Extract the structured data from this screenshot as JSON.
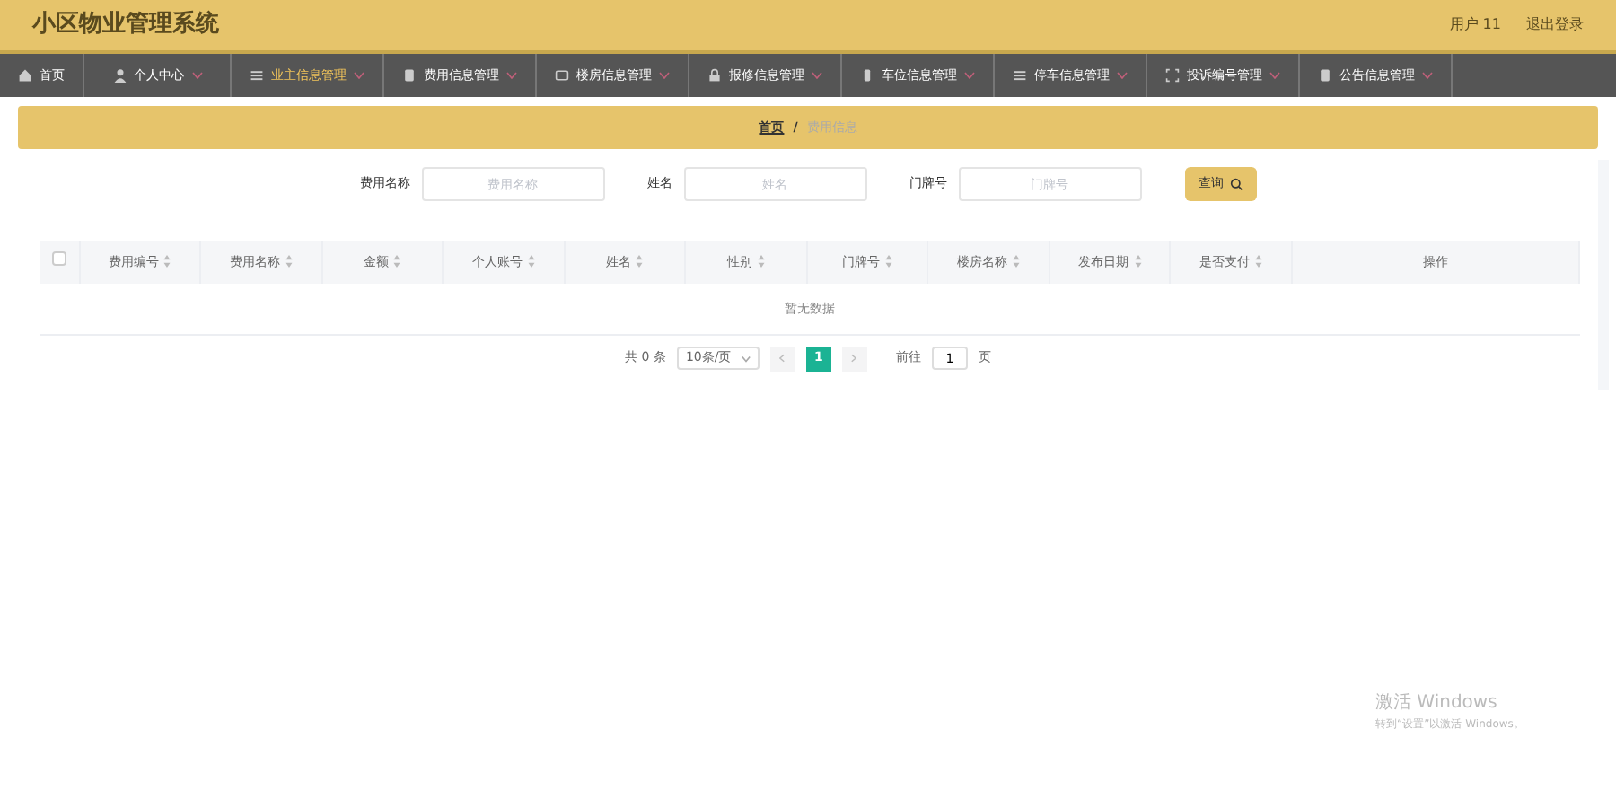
{
  "header": {
    "title": "小区物业管理系统",
    "user": "用户 11",
    "logout": "退出登录"
  },
  "nav": [
    {
      "label": "首页",
      "kind": "home",
      "dropdown": false,
      "selected": false
    },
    {
      "label": "个人中心",
      "kind": "person",
      "dropdown": true,
      "selected": false
    },
    {
      "label": "业主信息管理",
      "kind": "list",
      "dropdown": true,
      "selected": true
    },
    {
      "label": "费用信息管理",
      "kind": "doc",
      "dropdown": true,
      "selected": false
    },
    {
      "label": "楼房信息管理",
      "kind": "chat",
      "dropdown": true,
      "selected": false
    },
    {
      "label": "报修信息管理",
      "kind": "lock",
      "dropdown": true,
      "selected": false
    },
    {
      "label": "车位信息管理",
      "kind": "phone",
      "dropdown": true,
      "selected": false
    },
    {
      "label": "停车信息管理",
      "kind": "list",
      "dropdown": true,
      "selected": false
    },
    {
      "label": "投诉编号管理",
      "kind": "frame",
      "dropdown": true,
      "selected": false
    },
    {
      "label": "公告信息管理",
      "kind": "doc",
      "dropdown": true,
      "selected": false
    }
  ],
  "breadcrumb": {
    "items": [
      "首页",
      "费用信息"
    ],
    "separator": "/"
  },
  "search": {
    "fields": [
      {
        "label": "费用名称",
        "placeholder": "费用名称"
      },
      {
        "label": "姓名",
        "placeholder": "姓名"
      },
      {
        "label": "门牌号",
        "placeholder": "门牌号"
      }
    ],
    "button": "查询"
  },
  "table": {
    "select_all_checked": false,
    "columns": [
      {
        "label": "费用编号",
        "sortable": true
      },
      {
        "label": "费用名称",
        "sortable": true
      },
      {
        "label": "金额",
        "sortable": true
      },
      {
        "label": "个人账号",
        "sortable": true
      },
      {
        "label": "姓名",
        "sortable": true
      },
      {
        "label": "性别",
        "sortable": true
      },
      {
        "label": "门牌号",
        "sortable": true
      },
      {
        "label": "楼房名称",
        "sortable": true
      },
      {
        "label": "发布日期",
        "sortable": true
      },
      {
        "label": "是否支付",
        "sortable": true
      },
      {
        "label": "操作",
        "sortable": false
      }
    ],
    "empty_text": "暂无数据"
  },
  "pagination": {
    "total": "共 0 条",
    "page_size": "10条/页",
    "pages": [
      {
        "label": "1",
        "selected": true
      }
    ],
    "goto_label": "前往",
    "goto_value": "1",
    "page_unit": "页"
  },
  "activation_notice": {
    "title": "激活 Windows",
    "text": "转到“设置”以激活 Windows。"
  }
}
